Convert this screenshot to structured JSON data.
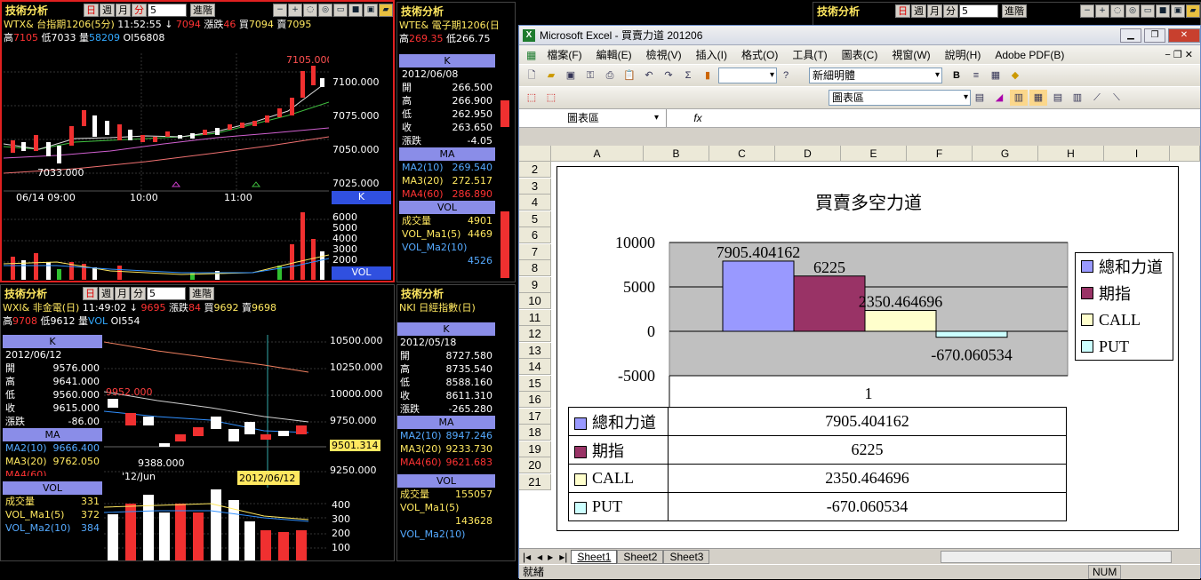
{
  "panels": {
    "p1": {
      "title": "技術分析",
      "btns": [
        "日",
        "週",
        "月",
        "分"
      ],
      "sel": "5",
      "advance": "進階",
      "sym": "WTX&",
      "name": "台指期1206(5分)",
      "time": "11:52:55",
      "arrow": "↓",
      "last": "7094",
      "chg_label": "漲跌",
      "chg": "46",
      "buy_label": "買",
      "buy": "7094",
      "sell_label": "賣",
      "sell": "7095",
      "hi_label": "高",
      "hi": "7105",
      "lo_label": "低",
      "lo": "7033",
      "vol_label": "量",
      "vol": "58209",
      "oi_label": "OI",
      "oi": "56808",
      "peak": "7105.000",
      "low_mark": "7033.000",
      "yaxis": [
        "7100.000",
        "7075.000",
        "7050.000",
        "7025.000"
      ],
      "xaxis": [
        "06/14 09:00",
        "10:00",
        "11:00"
      ],
      "k": "K",
      "vaxis": [
        "6000",
        "5000",
        "4000",
        "3000",
        "2000"
      ],
      "vol_tag": "VOL"
    },
    "p2": {
      "title": "技術分析",
      "btns": [
        "日",
        "週",
        "月",
        "分"
      ],
      "sel": "5",
      "advance": "進階",
      "sym": "WTE&",
      "name": "電子期1206(日",
      "hi_label": "高",
      "hi": "269.35",
      "lo_label": "低",
      "lo": "266.75",
      "k": "K",
      "date": "2012/06/08",
      "rows": [
        [
          "開",
          "266.500"
        ],
        [
          "高",
          "266.900"
        ],
        [
          "低",
          "262.950"
        ],
        [
          "收",
          "263.650"
        ],
        [
          "漲跌",
          "-4.05"
        ]
      ],
      "ma": "MA",
      "mas": [
        [
          "MA2(10)",
          "269.540"
        ],
        [
          "MA3(20)",
          "272.517"
        ],
        [
          "MA4(60)",
          "286.890"
        ]
      ],
      "vol": "VOL",
      "vols": [
        [
          "成交量",
          "4901"
        ],
        [
          "VOL_Ma1(5)",
          "4469"
        ],
        [
          "VOL_Ma2(10)",
          ""
        ],
        [
          "",
          "4526"
        ]
      ]
    },
    "p3": {
      "title": "技術分析",
      "btns": [
        "日",
        "週",
        "月",
        "分"
      ],
      "sel": "5",
      "advance": "進階"
    },
    "p4": {
      "title": "技術分析",
      "btns": [
        "日",
        "週",
        "月",
        "分"
      ],
      "sel": "5",
      "advance": "進階",
      "sym": "WXI&",
      "name": "非金電(日)",
      "time": "11:49:02",
      "arrow": "↓",
      "last": "9695",
      "chg_label": "漲跌",
      "chg": "84",
      "buy_label": "買",
      "buy": "9692",
      "sell_label": "賣",
      "sell": "9698",
      "hi_label": "高",
      "hi": "9708",
      "lo_label": "低",
      "lo": "9612",
      "vol_label": "量",
      "vol": "VOL",
      "oi_label": "OI",
      "oi": "554",
      "k": "K",
      "date": "2012/06/12",
      "rows": [
        [
          "開",
          "9576.000"
        ],
        [
          "高",
          "9641.000"
        ],
        [
          "低",
          "9560.000"
        ],
        [
          "收",
          "9615.000"
        ],
        [
          "漲跌",
          "-86.00"
        ]
      ],
      "ma": "MA",
      "mas": [
        [
          "MA2(10)",
          "9666.400"
        ],
        [
          "MA3(20)",
          "9762.050"
        ],
        [
          "MA4(60)",
          ""
        ]
      ],
      "vols": [
        [
          "成交量",
          "331"
        ],
        [
          "VOL_Ma1(5)",
          "372"
        ],
        [
          "VOL_Ma2(10)",
          "384"
        ]
      ],
      "yaxis": [
        "10500.000",
        "10250.000",
        "10000.000",
        "9750.000",
        "9250.000"
      ],
      "cur": "9501.314",
      "mark_hi": "9952.000",
      "mark_lo": "9388.000",
      "xlab": "'12/Jun",
      "xdate": "2012/06/12",
      "vaxis": [
        "400",
        "300",
        "200",
        "100"
      ]
    },
    "p5": {
      "title": "技術分析",
      "sym": "NKI",
      "name": "日經指數(日)",
      "k": "K",
      "date": "2012/05/18",
      "rows": [
        [
          "開",
          "8727.580"
        ],
        [
          "高",
          "8735.540"
        ],
        [
          "低",
          "8588.160"
        ],
        [
          "收",
          "8611.310"
        ],
        [
          "漲跌",
          "-265.280"
        ]
      ],
      "ma": "MA",
      "mas": [
        [
          "MA2(10)",
          "8947.246"
        ],
        [
          "MA3(20)",
          "9233.730"
        ],
        [
          "MA4(60)",
          "9621.683"
        ]
      ],
      "vol": "VOL",
      "vols": [
        [
          "成交量",
          "155057"
        ],
        [
          "VOL_Ma1(5)",
          ""
        ],
        [
          "",
          "143628"
        ],
        [
          "VOL_Ma2(10)",
          ""
        ]
      ]
    }
  },
  "excel": {
    "title": "Microsoft Excel - 買賣力道 201206",
    "menu": [
      "檔案(F)",
      "編輯(E)",
      "檢視(V)",
      "插入(I)",
      "格式(O)",
      "工具(T)",
      "圖表(C)",
      "視窗(W)",
      "說明(H)",
      "Adobe PDF(B)"
    ],
    "font": "新細明體",
    "bold": "B",
    "chartarea": "圖表區",
    "namebox": "圖表區",
    "fx": "fx",
    "cols": [
      "A",
      "B",
      "C",
      "D",
      "E",
      "F",
      "G",
      "H",
      "I"
    ],
    "rows": [
      "2",
      "3",
      "4",
      "5",
      "6",
      "7",
      "8",
      "9",
      "10",
      "11",
      "12",
      "13",
      "14",
      "15",
      "16",
      "17",
      "18",
      "19",
      "20",
      "21"
    ],
    "sheets": [
      "Sheet1",
      "Sheet2",
      "Sheet3"
    ],
    "status": "就緒",
    "num": "NUM"
  },
  "chart_data": {
    "type": "bar",
    "title": "買賣多空力道",
    "categories": [
      "1"
    ],
    "series": [
      {
        "name": "總和力道",
        "values": [
          7905.404162
        ],
        "label": "7905.404162",
        "color": "#9999ff"
      },
      {
        "name": "期指",
        "values": [
          6225
        ],
        "label": "6225",
        "color": "#993366"
      },
      {
        "name": "CALL",
        "values": [
          2350.464696
        ],
        "label": "2350.464696",
        "color": "#ffffcc"
      },
      {
        "name": "PUT",
        "values": [
          -670.060534
        ],
        "label": "-670.060534",
        "color": "#ccffff"
      }
    ],
    "yticks": [
      "10000",
      "5000",
      "0",
      "-5000"
    ],
    "ylim": [
      -5000,
      10000
    ],
    "legend": "right",
    "grid": true
  }
}
